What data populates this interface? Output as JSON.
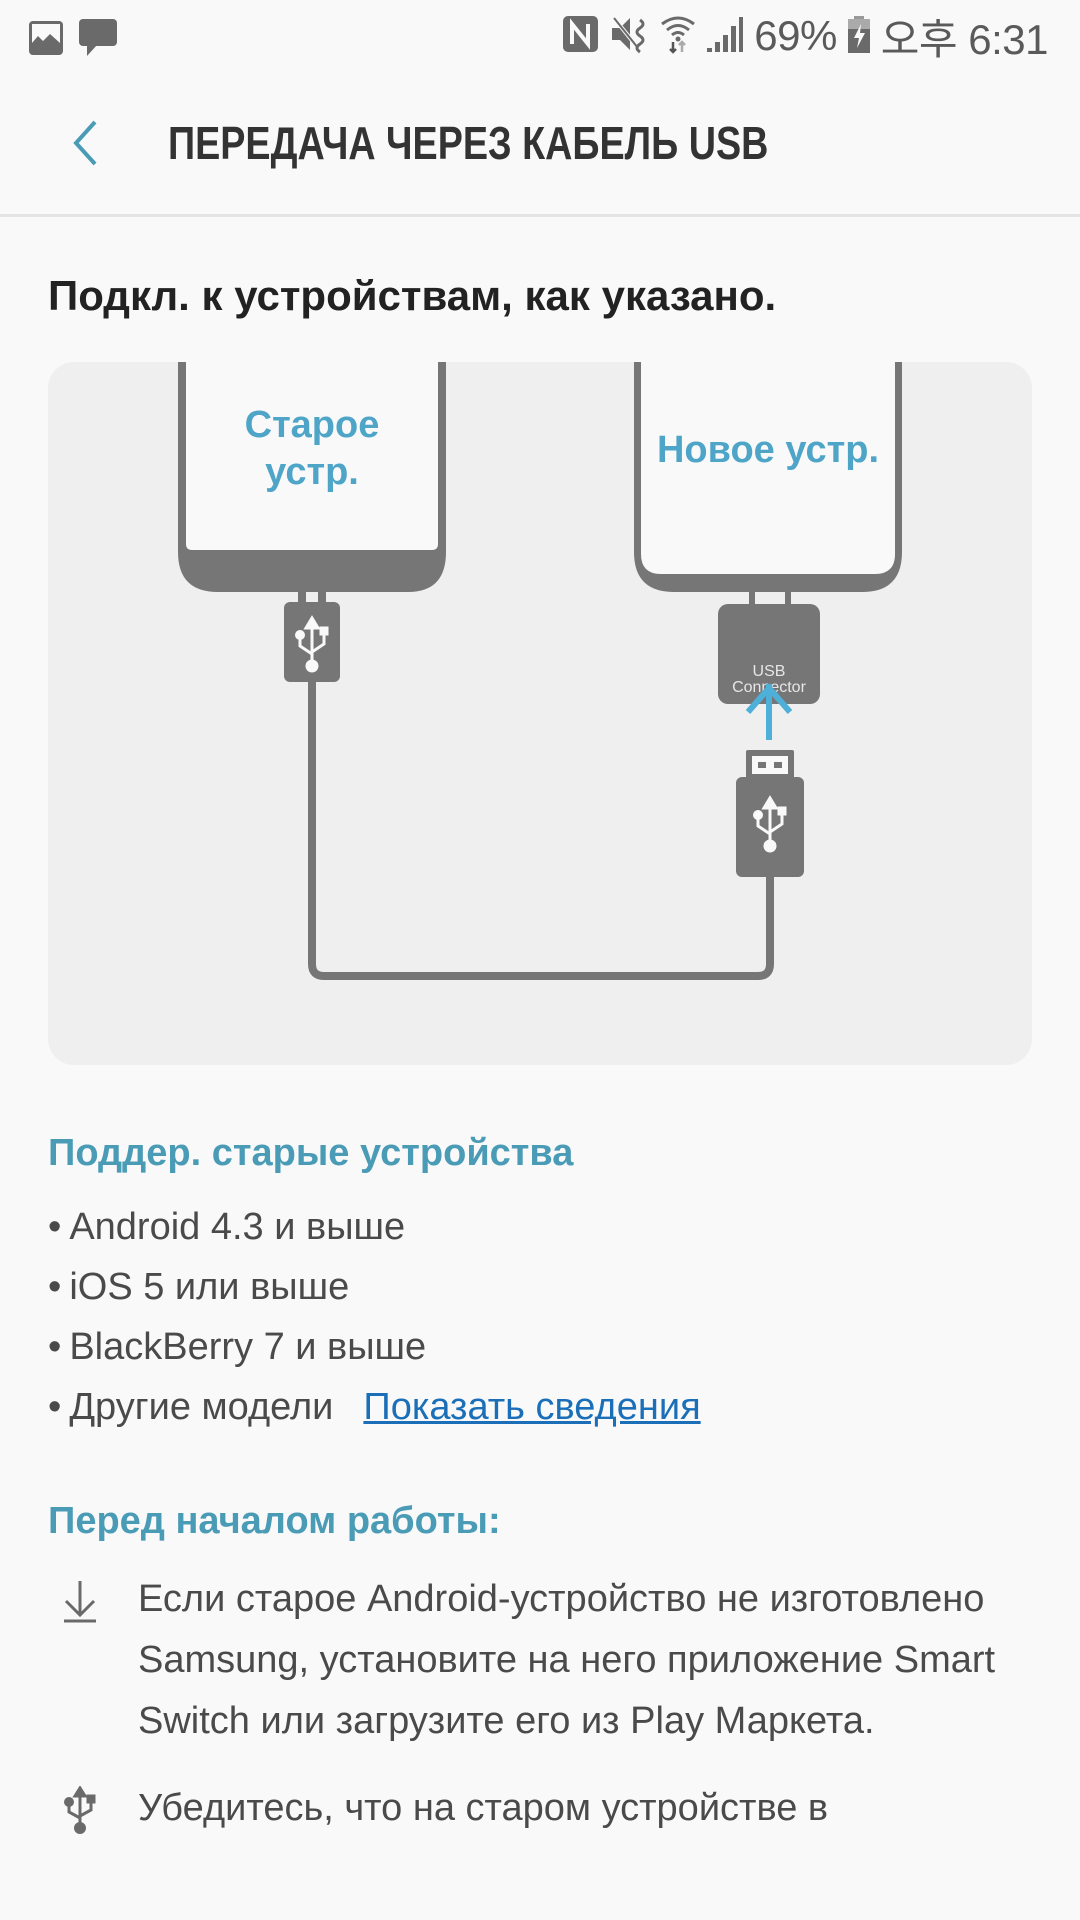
{
  "status_bar": {
    "left_icons": [
      "gallery-icon",
      "message-icon"
    ],
    "right_icons": [
      "nfc-icon",
      "vibrate-mute-icon",
      "wifi-icon",
      "signal-icon"
    ],
    "battery_percent": "69%",
    "battery_icon": "battery-charging-icon",
    "time": "오후 6:31"
  },
  "app_bar": {
    "back_icon": "chevron-left-icon",
    "title": "ПЕРЕДАЧА ЧЕРЕЗ КАБЕЛЬ USB"
  },
  "instruction": "Подкл. к устройствам, как указано.",
  "illustration": {
    "old_device_label_line1": "Старое",
    "old_device_label_line2": "устр.",
    "new_device_label": "Новое устр.",
    "connector_label_line1": "USB",
    "connector_label_line2": "Connector",
    "colors": {
      "device_gray": "#767676",
      "label_blue": "#4ea5c8",
      "arrow_blue": "#4eb0d8",
      "background": "#efefef"
    }
  },
  "supported": {
    "title": "Поддер. старые устройства",
    "items": [
      {
        "text": "Android 4.3 и выше"
      },
      {
        "text": "iOS 5 или выше"
      },
      {
        "text": "BlackBerry 7 и выше"
      },
      {
        "text": "Другие модели",
        "link": "Показать сведения"
      }
    ]
  },
  "before_start": {
    "title": "Перед началом работы:",
    "tips": [
      {
        "icon": "download-icon",
        "text": "Если старое Android-устройство не изготовлено Samsung, установите на него приложение Smart Switch или загрузите его из Play Маркета."
      },
      {
        "icon": "usb-icon",
        "text": "Убедитесь, что на старом устройстве в"
      }
    ]
  },
  "colors": {
    "accent": "#4a9bb5",
    "link": "#1b6fb8",
    "text_primary": "#222222",
    "text_body": "#4a4a4a",
    "background": "#f9f9f9"
  }
}
